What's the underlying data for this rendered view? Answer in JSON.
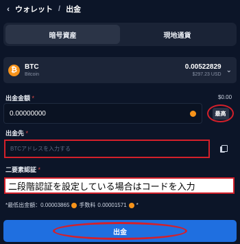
{
  "header": {
    "back_icon": "chevron-left-icon",
    "back_glyph": "‹",
    "wallet": "ウォレット",
    "separator": "/",
    "title": "出金"
  },
  "tabs": [
    {
      "label": "暗号資産",
      "active": true
    },
    {
      "label": "現地通貨",
      "active": false
    }
  ],
  "coin": {
    "symbol": "BTC",
    "name": "Bitcoin",
    "logo_glyph": "₿",
    "balance": "0.00522829",
    "balance_usd": "$297.23 USD",
    "chevron": "⌄",
    "brand_color": "#f7931a"
  },
  "amount": {
    "label": "出金金額",
    "required_mark": "*",
    "available": "$0.00",
    "value": "0.00000000",
    "max_label": "最高"
  },
  "address": {
    "label": "出金先",
    "required_mark": "*",
    "placeholder": "BTCアドレスを入力する"
  },
  "tfa": {
    "label": "二要素認証",
    "required_mark": "*",
    "overlay_text": "二段階認証を設定している場合はコードを入力"
  },
  "fees": {
    "prefix": "*最低出金額：",
    "min": "0.00003865",
    "fee_label": "手数料",
    "fee": "0.00001571",
    "suffix": "*"
  },
  "submit_label": "出金",
  "colors": {
    "background": "#0c1528",
    "accent": "#1f6fe0",
    "annotation_red": "#d4202a"
  }
}
